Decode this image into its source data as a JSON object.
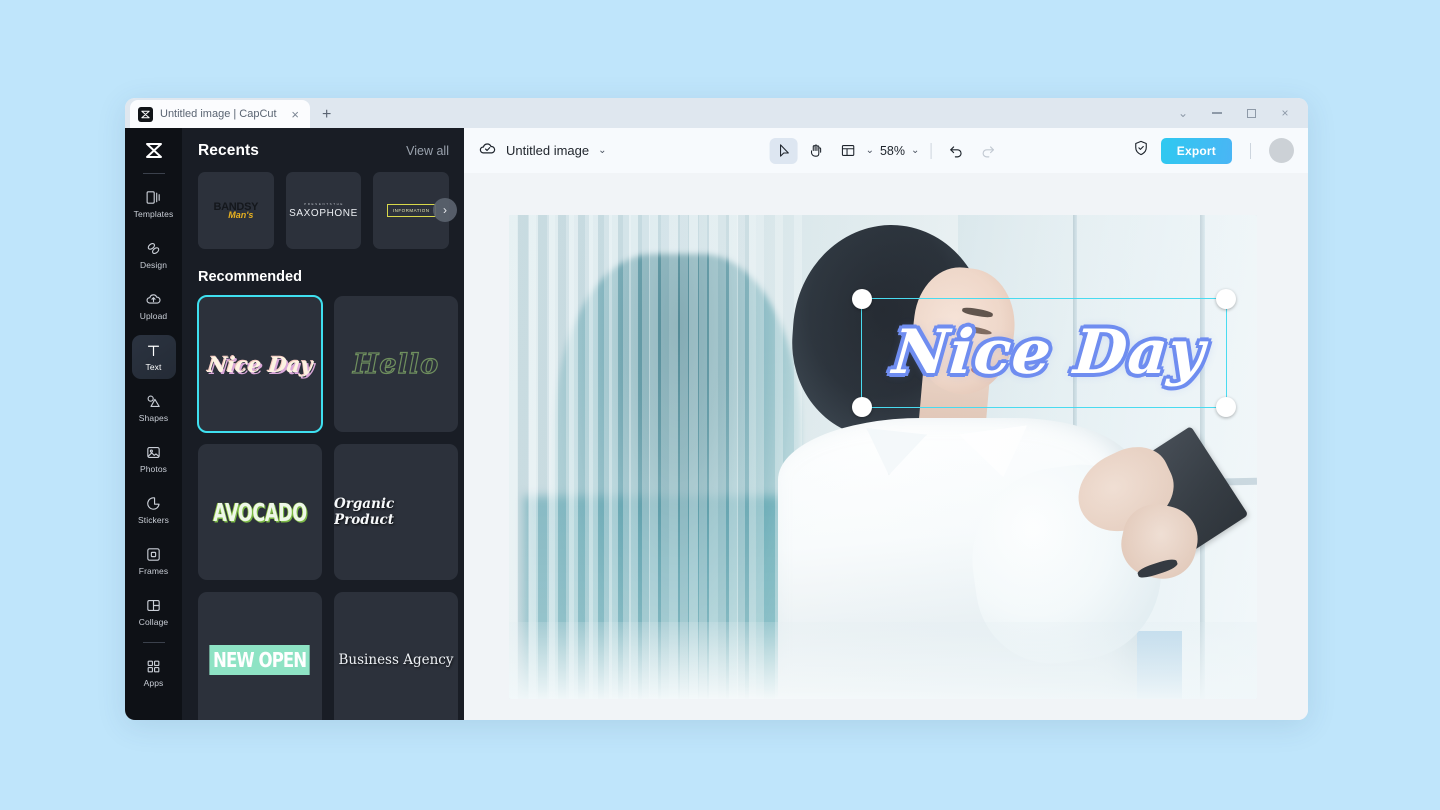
{
  "browser": {
    "tab": {
      "title": "Untitled image | CapCut",
      "favicon": "capcut-logo-icon",
      "close": "×"
    },
    "new_tab": "+",
    "window_controls": {
      "chevron": "⌄",
      "minimize": "—",
      "maximize": "□",
      "close": "×"
    }
  },
  "rail": {
    "logo": "capcut-logo-icon",
    "items": [
      {
        "label": "Templates",
        "icon": "templates-icon",
        "active": false
      },
      {
        "label": "Design",
        "icon": "design-icon",
        "active": false
      },
      {
        "label": "Upload",
        "icon": "upload-cloud-icon",
        "active": false
      },
      {
        "label": "Text",
        "icon": "text-t-icon",
        "active": true
      },
      {
        "label": "Shapes",
        "icon": "shapes-icon",
        "active": false
      },
      {
        "label": "Photos",
        "icon": "photos-image-icon",
        "active": false
      },
      {
        "label": "Stickers",
        "icon": "stickers-icon",
        "active": false
      },
      {
        "label": "Frames",
        "icon": "frames-icon",
        "active": false
      },
      {
        "label": "Collage",
        "icon": "collage-icon",
        "active": false
      },
      {
        "label": "Apps",
        "icon": "apps-grid-icon",
        "active": false
      }
    ]
  },
  "panel": {
    "recents_title": "Recents",
    "view_all": "View all",
    "next_arrow": "›",
    "recents": [
      {
        "name": "BANDSY",
        "name2": "Man's",
        "kind": "bandsy"
      },
      {
        "name": "SAXOPHONE",
        "name2": "P R E S E N T S   T H E",
        "kind": "saxophone"
      },
      {
        "name": "INFORMATION",
        "kind": "information"
      }
    ],
    "recommended_title": "Recommended",
    "templates": [
      {
        "label": "Nice Day",
        "kind": "niceday",
        "selected": true
      },
      {
        "label": "Hello",
        "kind": "hello",
        "selected": false
      },
      {
        "label": "AVOCADO",
        "kind": "avocado",
        "selected": false
      },
      {
        "label": "Organic Product",
        "kind": "organic",
        "selected": false
      },
      {
        "label": "NEW OPEN",
        "kind": "newopen",
        "selected": false
      },
      {
        "label": "Business Agency",
        "kind": "business",
        "selected": false
      }
    ]
  },
  "toolbar": {
    "cloud_icon": "cloud-saved-icon",
    "doc_name": "Untitled image",
    "doc_chevron": "⌄",
    "select_tool": "cursor-arrow-icon",
    "hand_tool": "hand-pan-icon",
    "layout_tool": "layout-panels-icon",
    "layout_chevron": "⌄",
    "zoom_value": "58%",
    "zoom_chevron": "⌄",
    "undo": "undo-arrow-icon",
    "redo": "redo-arrow-icon",
    "shield": "shield-check-icon",
    "export_label": "Export",
    "avatar": "user-avatar"
  },
  "canvas": {
    "text_layer": "Nice Day",
    "selection": {
      "handles": 4
    }
  },
  "colors": {
    "page_background": "#bfe5fb",
    "accent_cyan": "#49dbf0",
    "export_gradient_start": "#2ec9f0",
    "export_gradient_end": "#4ab5f5",
    "rail_background": "#0e1116",
    "panel_background": "#191d25",
    "card_background": "#2c313b",
    "editor_background": "#f1f4f7",
    "text_outline_blue": "#6f8df0"
  }
}
